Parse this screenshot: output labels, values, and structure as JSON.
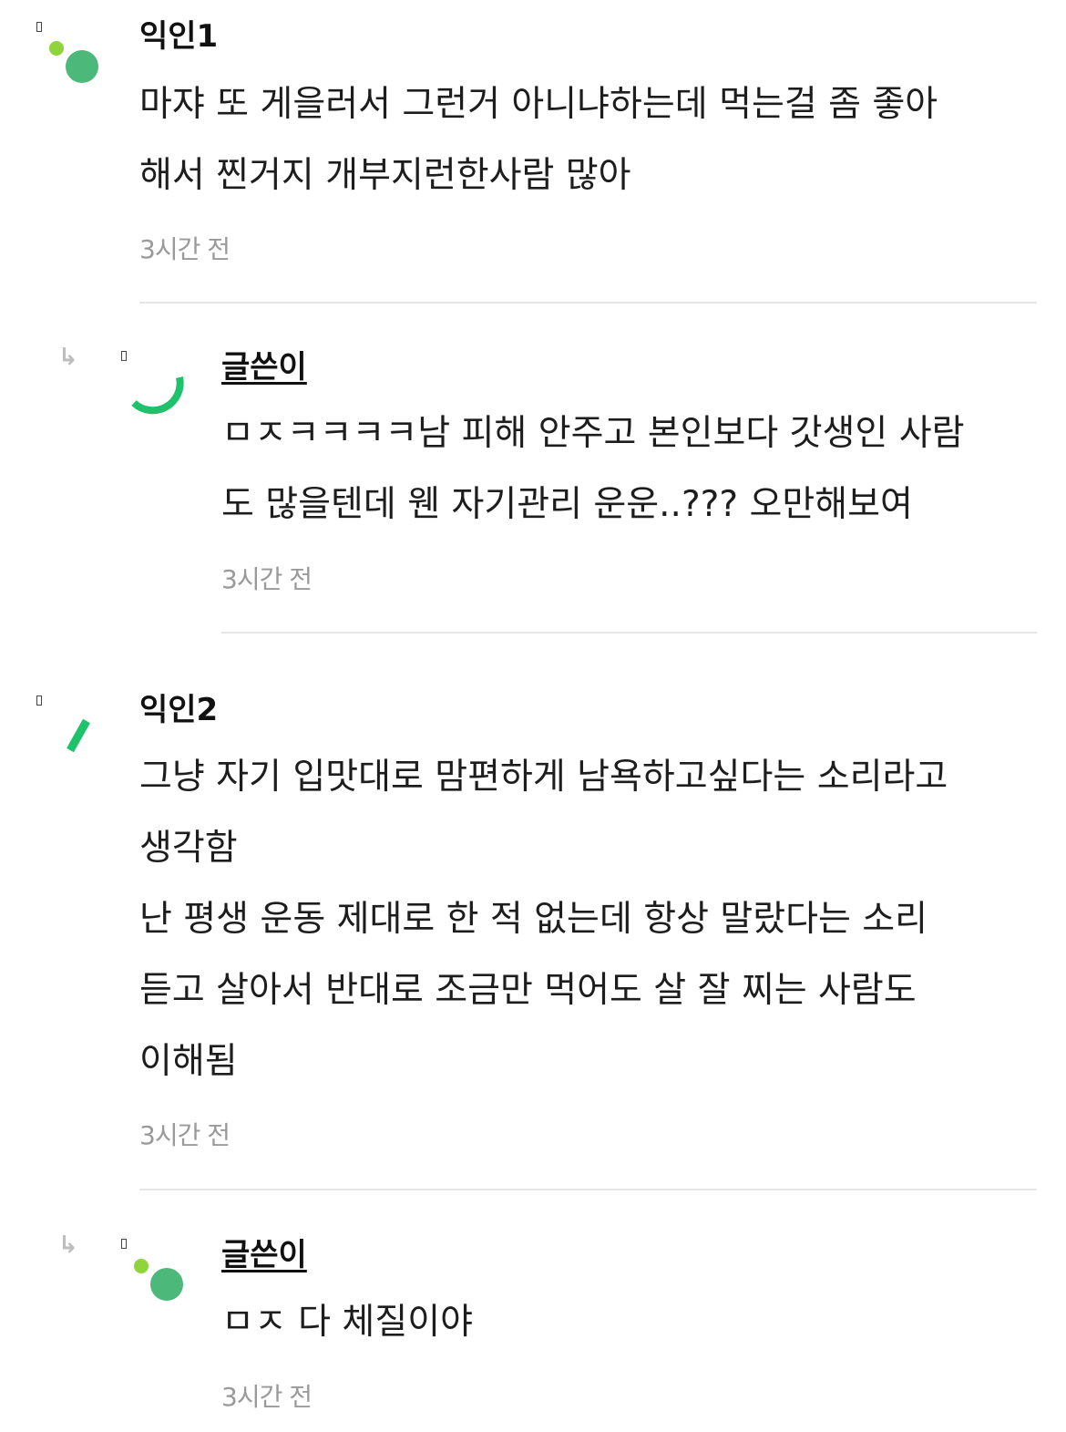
{
  "comments": [
    {
      "author": "익인1",
      "text": "마쟈 또 게을러서 그런거 아니냐하는데 먹는걸 좀 좋아\n해서 찐거지 개부지런한사람 많아",
      "time": "3시간 전",
      "is_reply": false,
      "avatar_icon": "dots-avatar-icon"
    },
    {
      "author": "글쓴이",
      "text": "ㅁㅈㅋㅋㅋㅋ남 피해 안주고 본인보다 갓생인 사람\n도 많을텐데 웬 자기관리 운운..??? 오만해보여",
      "time": "3시간 전",
      "is_reply": true,
      "avatar_icon": "arc-avatar-icon"
    },
    {
      "author": "익인2",
      "text": "그냥 자기 입맛대로 맘편하게 남욕하고싶다는 소리라고\n생각함\n난 평생 운동 제대로 한 적 없는데 항상 말랐다는 소리\n듣고 살아서 반대로 조금만 먹어도 살 잘 찌는 사람도\n이해됨",
      "time": "3시간 전",
      "is_reply": false,
      "avatar_icon": "slash-avatar-icon"
    },
    {
      "author": "글쓴이",
      "text": "ㅁㅈ 다 체질이야",
      "time": "3시간 전",
      "is_reply": true,
      "avatar_icon": "dots-avatar-icon"
    }
  ],
  "colors": {
    "avatar_green": "#4cb87a",
    "avatar_lime": "#8ed43a",
    "accent_green": "#1ec26a",
    "time_gray": "#9a9a9a",
    "divider_gray": "#e6e6e6"
  }
}
